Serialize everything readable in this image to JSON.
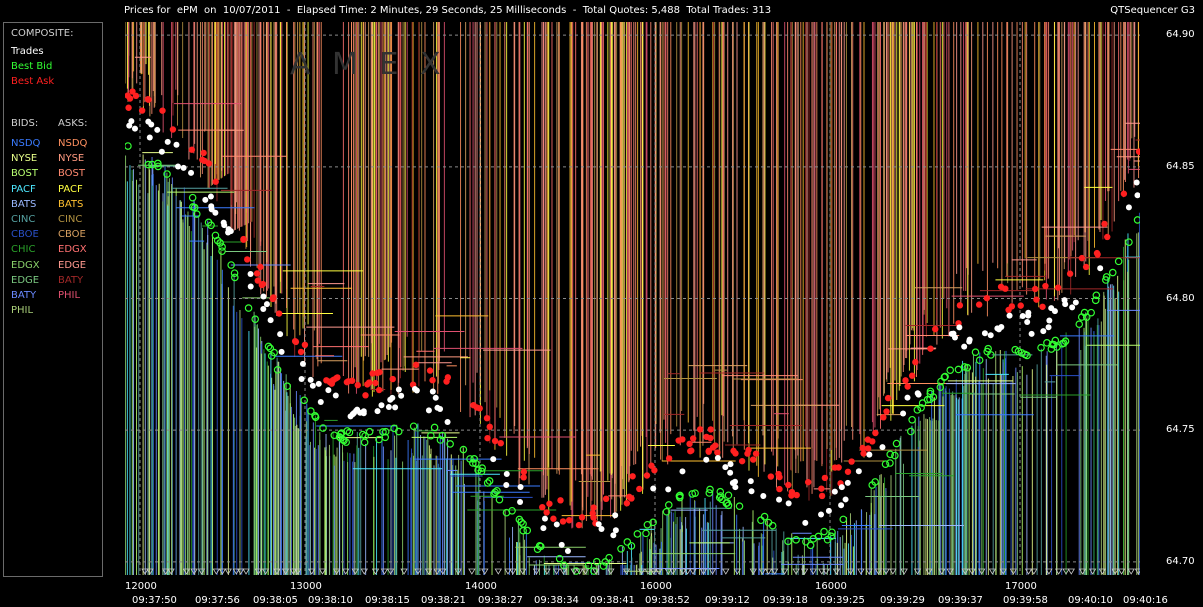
{
  "header": {
    "title": "Prices for  ePM  on  10/07/2011  -  Elapsed Time: 2 Minutes, 29 Seconds, 25 Milliseconds  -  Total Quotes: 5,488  Total Trades: 313",
    "brand": "QTSequencer G3"
  },
  "legend": {
    "composite_label": "COMPOSITE:",
    "composite": [
      {
        "label": "Trades",
        "color": "#ffffff"
      },
      {
        "label": "Best Bid",
        "color": "#33ff33"
      },
      {
        "label": "Best Ask",
        "color": "#ff2020"
      }
    ],
    "bids_label": "BIDS:",
    "asks_label": "ASKS:",
    "bids": [
      {
        "label": "NSDQ",
        "color": "#3a7bff"
      },
      {
        "label": "NYSE",
        "color": "#e8ff8a"
      },
      {
        "label": "BOST",
        "color": "#b8ff70"
      },
      {
        "label": "PACF",
        "color": "#4de8ff"
      },
      {
        "label": "BATS",
        "color": "#9ab8ff"
      },
      {
        "label": "CINC",
        "color": "#55a0a0"
      },
      {
        "label": "CBOE",
        "color": "#2a50c8"
      },
      {
        "label": "CHIC",
        "color": "#2aa02a"
      },
      {
        "label": "EDGX",
        "color": "#8ad06a"
      },
      {
        "label": "EDGE",
        "color": "#7ac880"
      },
      {
        "label": "BATY",
        "color": "#6a8aff"
      },
      {
        "label": "PHIL",
        "color": "#aad07a"
      }
    ],
    "asks": [
      {
        "label": "NSDQ",
        "color": "#ff9060"
      },
      {
        "label": "NYSE",
        "color": "#ff9a80"
      },
      {
        "label": "BOST",
        "color": "#ff8a70"
      },
      {
        "label": "PACF",
        "color": "#ffff40"
      },
      {
        "label": "BATS",
        "color": "#ffc030"
      },
      {
        "label": "CINC",
        "color": "#b09040"
      },
      {
        "label": "CBOE",
        "color": "#d8a060"
      },
      {
        "label": "EDGX",
        "color": "#ff7070"
      },
      {
        "label": "EDGE",
        "color": "#ff9a90"
      },
      {
        "label": "BATY",
        "color": "#a02828"
      },
      {
        "label": "PHIL",
        "color": "#e05070"
      }
    ]
  },
  "watermark": "A M E X",
  "y_axis": {
    "ticks": [
      "64.90",
      "64.85",
      "64.80",
      "64.75",
      "64.70"
    ],
    "values": [
      64.9,
      64.85,
      64.8,
      64.75,
      64.7
    ]
  },
  "x_axis": {
    "sequence_labels": [
      "12000",
      "13000",
      "14000",
      "16000",
      "16000",
      "17000"
    ],
    "time_labels": [
      "09:37:50",
      "09:37:56",
      "09:38:05",
      "09:38:10",
      "09:38:15",
      "09:38:21",
      "09:38:27",
      "09:38:34",
      "09:38:41",
      "09:38:52",
      "09:39:12",
      "09:39:18",
      "09:39:25",
      "09:39:29",
      "09:39:37",
      "09:39:58",
      "09:40:10",
      "09:40:16"
    ]
  },
  "colors": {
    "background": "#000000",
    "grid": "#8a8a8a",
    "trade": "#ffffff",
    "best_bid": "#33ff33",
    "best_ask": "#ff2020"
  }
}
